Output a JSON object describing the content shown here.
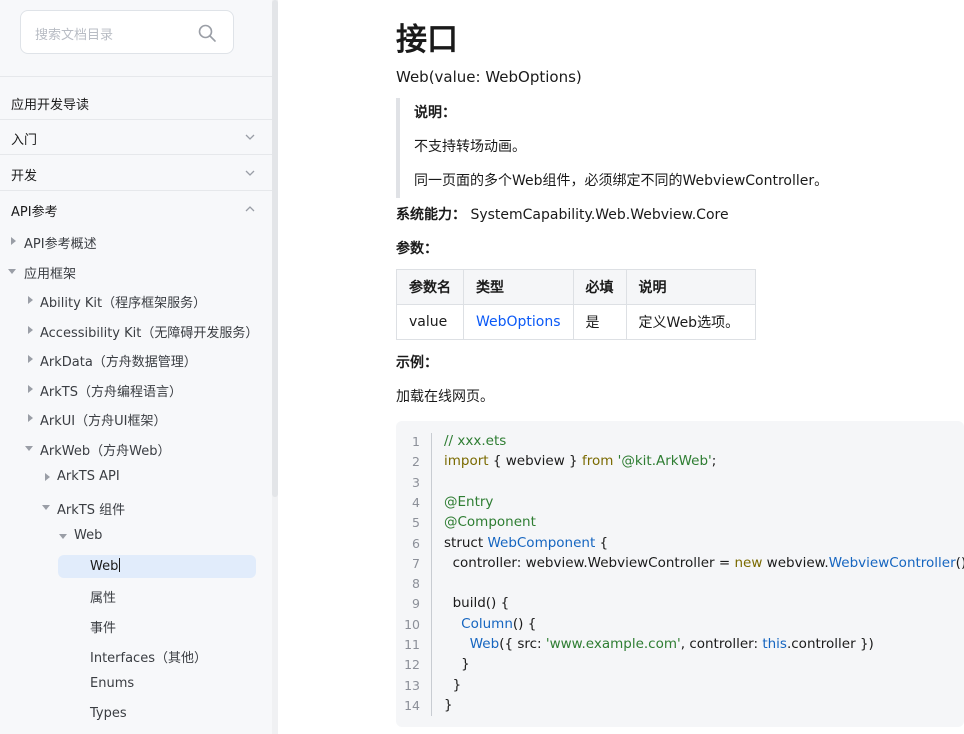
{
  "sidebar": {
    "search_placeholder": "搜索文档目录",
    "top_items": [
      {
        "label": "应用开发导读",
        "chevron": "none"
      },
      {
        "label": "入门",
        "chevron": "down"
      },
      {
        "label": "开发",
        "chevron": "down"
      },
      {
        "label": "API参考",
        "chevron": "up"
      }
    ],
    "tree": [
      {
        "label": "API参考概述",
        "level": 0,
        "expand": "right"
      },
      {
        "label": "应用框架",
        "level": 0,
        "expand": "down"
      },
      {
        "label": "Ability Kit（程序框架服务）",
        "level": 1,
        "expand": "right"
      },
      {
        "label": "Accessibility Kit（无障碍开发服务）",
        "level": 1,
        "expand": "right"
      },
      {
        "label": "ArkData（方舟数据管理）",
        "level": 1,
        "expand": "right"
      },
      {
        "label": "ArkTS（方舟编程语言）",
        "level": 1,
        "expand": "right"
      },
      {
        "label": "ArkUI（方舟UI框架）",
        "level": 1,
        "expand": "right"
      },
      {
        "label": "ArkWeb（方舟Web）",
        "level": 1,
        "expand": "down"
      },
      {
        "label": "ArkTS API",
        "level": 2,
        "expand": "right"
      },
      {
        "label": "ArkTS 组件",
        "level": 2,
        "expand": "down"
      },
      {
        "label": "Web",
        "level": 3,
        "expand": "down"
      },
      {
        "label": "Web",
        "level": 4,
        "expand": "none",
        "selected": true
      },
      {
        "label": "属性",
        "level": 4,
        "expand": "none"
      },
      {
        "label": "事件",
        "level": 4,
        "expand": "none"
      },
      {
        "label": "Interfaces（其他）",
        "level": 4,
        "expand": "none"
      },
      {
        "label": "Enums",
        "level": 4,
        "expand": "none"
      },
      {
        "label": "Types",
        "level": 4,
        "expand": "none"
      }
    ]
  },
  "main": {
    "title": "接口",
    "signature": "Web(value: WebOptions)",
    "note": {
      "heading": "说明：",
      "lines": [
        "不支持转场动画。",
        "同一页面的多个Web组件，必须绑定不同的WebviewController。"
      ]
    },
    "sys_cap_label": "系统能力：",
    "sys_cap_value": "SystemCapability.Web.Webview.Core",
    "params_title": "参数：",
    "params_table": {
      "headers": [
        "参数名",
        "类型",
        "必填",
        "说明"
      ],
      "rows": [
        [
          "value",
          "WebOptions",
          "是",
          "定义Web选项。"
        ]
      ]
    },
    "example_title": "示例：",
    "example_desc": "加载在线网页。",
    "code_lines": [
      [
        [
          "// xxx.ets",
          "comment"
        ]
      ],
      [
        [
          "import",
          "kw"
        ],
        [
          " { webview } ",
          ""
        ],
        [
          "from",
          "kw"
        ],
        [
          " ",
          ""
        ],
        [
          "'@kit.ArkWeb'",
          "str"
        ],
        [
          ";",
          ""
        ]
      ],
      [],
      [
        [
          "@Entry",
          "anno"
        ]
      ],
      [
        [
          "@Component",
          "anno"
        ]
      ],
      [
        [
          "struct ",
          ""
        ],
        [
          "WebComponent",
          "type"
        ],
        [
          " {",
          ""
        ]
      ],
      [
        [
          "  controller: webview.WebviewController = ",
          ""
        ],
        [
          "new",
          "kw"
        ],
        [
          " webview.",
          ""
        ],
        [
          "WebviewController",
          "type"
        ],
        [
          "();",
          ""
        ]
      ],
      [],
      [
        [
          "  build() {",
          ""
        ]
      ],
      [
        [
          "    ",
          ""
        ],
        [
          "Column",
          "type"
        ],
        [
          "() {",
          ""
        ]
      ],
      [
        [
          "      ",
          ""
        ],
        [
          "Web",
          "type"
        ],
        [
          "({ src: ",
          ""
        ],
        [
          "'www.example.com'",
          "str"
        ],
        [
          ", controller: ",
          ""
        ],
        [
          "this",
          "type"
        ],
        [
          ".controller })",
          ""
        ]
      ],
      [
        [
          "    }",
          ""
        ]
      ],
      [
        [
          "  }",
          ""
        ]
      ],
      [
        [
          "}",
          ""
        ]
      ]
    ]
  }
}
